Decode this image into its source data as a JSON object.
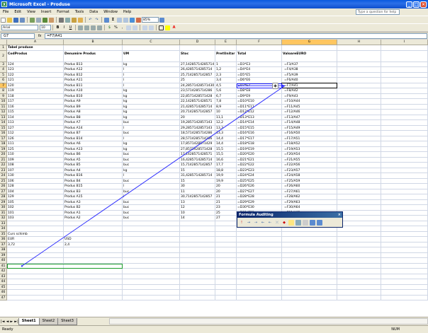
{
  "window": {
    "title": "Microsoft Excel - Produse",
    "app_icon": "X"
  },
  "menu": {
    "items": [
      "File",
      "Edit",
      "View",
      "Insert",
      "Format",
      "Tools",
      "Data",
      "Window",
      "Help"
    ],
    "help_placeholder": "Type a question for help"
  },
  "toolbar": {
    "font": "Arial",
    "size": "10",
    "zoom": "85%"
  },
  "formula_bar": {
    "name_box": "G7",
    "fx": "fx",
    "formula": "=F7/A41"
  },
  "columns": [
    "A",
    "B",
    "C",
    "D",
    "E",
    "F",
    "G",
    "H",
    "I"
  ],
  "row_numbers": [
    "1",
    "2",
    "3",
    "4",
    "5",
    "6",
    "7",
    "8",
    "9",
    "10",
    "11",
    "12",
    "13",
    "14",
    "15",
    "16",
    "17",
    "18",
    "19",
    "20",
    "21",
    "22",
    "23",
    "24",
    "25",
    "26",
    "27",
    "28",
    "29",
    "30",
    "31",
    "32",
    "33",
    "34",
    "35",
    "36",
    "37",
    "38",
    "39",
    "40",
    "41",
    "42",
    "43",
    "44",
    "45",
    "46",
    "47"
  ],
  "sheet": {
    "title": "Tabel produse",
    "headers": [
      "CodProdus",
      "Denumire Produs",
      "UM",
      "Stoc",
      "PretUnitar",
      "Total",
      "ValoareEURO"
    ],
    "rows": [
      [
        "124",
        "Produs B13",
        "kg",
        "27,14285714285714",
        "1",
        "=D3*E3",
        "=F3/A37"
      ],
      [
        "123",
        "Produs A12",
        "l",
        "26,4285714285714",
        "1,2",
        "=D4*E4",
        "=F4/A38"
      ],
      [
        "122",
        "Produs B12",
        "l",
        "25,7142857142857",
        "2,3",
        "=D5*E5",
        "=F5/A39"
      ],
      [
        "121",
        "Produs A11",
        "l",
        "25",
        "3,4",
        "=D6*E6",
        "=F6/A40"
      ],
      [
        "120",
        "Produs B11",
        "l",
        "24,28571428571430",
        "4,5",
        "=D7*E7",
        "=F7/A41"
      ],
      [
        "119",
        "Produs A10",
        "kg",
        "23,5714285714286",
        "5,6",
        "=D8*E8",
        "=F8/A42"
      ],
      [
        "118",
        "Produs B10",
        "kg",
        "22,8571428571428",
        "6,7",
        "=D9*E9",
        "=F9/A43"
      ],
      [
        "117",
        "Produs A9",
        "kg",
        "22,1428571428571",
        "7,8",
        "=D10*E10",
        "=F10/A44"
      ],
      [
        "116",
        "Produs B9",
        "kg",
        "21,4285714285714",
        "8,9",
        "=D11*E11",
        "=F11/A45"
      ],
      [
        "115",
        "Produs A8",
        "kg",
        "20,7142857142857",
        "10",
        "=D12*E12",
        "=F12/A46"
      ],
      [
        "114",
        "Produs B8",
        "kg",
        "20",
        "11,1",
        "=D13*E13",
        "=F13/A47"
      ],
      [
        "113",
        "Produs A7",
        "buc",
        "19,2857142857143",
        "12,2",
        "=D14*E14",
        "=F14/A48"
      ],
      [
        "127",
        "Produs A14",
        "l",
        "29,2857142857143",
        "13,3",
        "=D15*E15",
        "=F15/A49"
      ],
      [
        "112",
        "Produs B7",
        "buc",
        "18,5714285714286",
        "13,3",
        "=D16*E16",
        "=F16/A50"
      ],
      [
        "126",
        "Produs B14",
        "l",
        "28,5714285714286",
        "14,4",
        "=D17*E17",
        "=F17/A51"
      ],
      [
        "111",
        "Produs A6",
        "kg",
        "17,8571428571429",
        "14,4",
        "=D18*E18",
        "=F18/A52"
      ],
      [
        "125",
        "Produs A13",
        "kg",
        "27,8571428571428",
        "15,5",
        "=D19*E19",
        "=F19/A53"
      ],
      [
        "110",
        "Produs B6",
        "buc",
        "17,1428571428571",
        "15,5",
        "=D20*E20",
        "=F20/A54"
      ],
      [
        "109",
        "Produs A5",
        "buc",
        "16,4285714285714",
        "16,6",
        "=D21*E21",
        "=F21/A55"
      ],
      [
        "108",
        "Produs B5",
        "buc",
        "15,7142857142857",
        "17,7",
        "=D22*E22",
        "=F22/A56"
      ],
      [
        "107",
        "Produs A4",
        "kg",
        "15",
        "18,8",
        "=D23*E23",
        "=F23/A57"
      ],
      [
        "130",
        "Produs B16",
        "l",
        "31,4285714285714",
        "19,9",
        "=D24*E24",
        "=F24/A58"
      ],
      [
        "106",
        "Produs B4",
        "buc",
        "15",
        "19,9",
        "=D25*E25",
        "=F25/A59"
      ],
      [
        "128",
        "Produs B15",
        "l",
        "30",
        "20",
        "=D26*E26",
        "=F26/A60"
      ],
      [
        "104",
        "Produs B3",
        "buc",
        "11",
        "20",
        "=D27*E27",
        "=F27/A61"
      ],
      [
        "129",
        "Produs A15",
        "l",
        "30,7142857142857",
        "21",
        "=D28*E28",
        "=F28/A62"
      ],
      [
        "105",
        "Produs A3",
        "buc",
        "13",
        "21",
        "=D29*E29",
        "=F29/A63"
      ],
      [
        "102",
        "Produs B2",
        "buc",
        "12",
        "23",
        "=D30*E30",
        "=F30/A64"
      ],
      [
        "101",
        "Produs A1",
        "buc",
        "10",
        "25",
        "=D31*E31",
        "=F31/A65"
      ],
      [
        "103",
        "Produs A2",
        "buc",
        "14",
        "27",
        "=D32*E32",
        "=F32/A66"
      ]
    ],
    "curs_label": "Curs schimb",
    "eur_label": "EUR",
    "usd_label": "USD",
    "eur_value": "3,72",
    "usd_value": "2,4"
  },
  "formula_auditing": {
    "title": "Formula Auditing",
    "close": "×"
  },
  "tabs": [
    "Sheet1",
    "Sheet2",
    "Sheet3"
  ],
  "status": {
    "ready": "Ready",
    "num": "NUM"
  }
}
